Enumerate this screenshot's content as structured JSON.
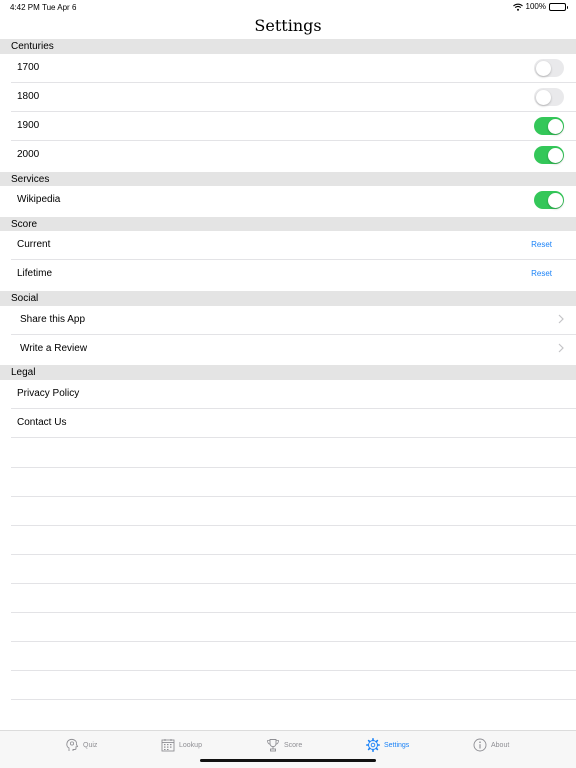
{
  "status": {
    "time": "4:42 PM",
    "date": "Tue Apr 6",
    "battery": "100%"
  },
  "title": "Settings",
  "sections": {
    "centuries": {
      "header": "Centuries",
      "items": [
        {
          "label": "1700",
          "on": false
        },
        {
          "label": "1800",
          "on": false
        },
        {
          "label": "1900",
          "on": true
        },
        {
          "label": "2000",
          "on": true
        }
      ]
    },
    "services": {
      "header": "Services",
      "items": [
        {
          "label": "Wikipedia",
          "on": true
        }
      ]
    },
    "score": {
      "header": "Score",
      "items": [
        {
          "label": "Current",
          "action": "Reset"
        },
        {
          "label": "Lifetime",
          "action": "Reset"
        }
      ]
    },
    "social": {
      "header": "Social",
      "items": [
        {
          "label": "Share this App"
        },
        {
          "label": "Write a Review"
        }
      ]
    },
    "legal": {
      "header": "Legal",
      "items": [
        {
          "label": "Privacy Policy"
        },
        {
          "label": "Contact Us"
        }
      ]
    }
  },
  "tabs": [
    {
      "label": "Quiz",
      "icon": "head-icon",
      "active": false
    },
    {
      "label": "Lookup",
      "icon": "calendar-icon",
      "active": false
    },
    {
      "label": "Score",
      "icon": "trophy-icon",
      "active": false
    },
    {
      "label": "Settings",
      "icon": "gear-icon",
      "active": true
    },
    {
      "label": "About",
      "icon": "info-icon",
      "active": false
    }
  ],
  "colors": {
    "toggle_on": "#34c759",
    "accent": "#1a82f7",
    "section_bg": "#e4e4e4"
  }
}
